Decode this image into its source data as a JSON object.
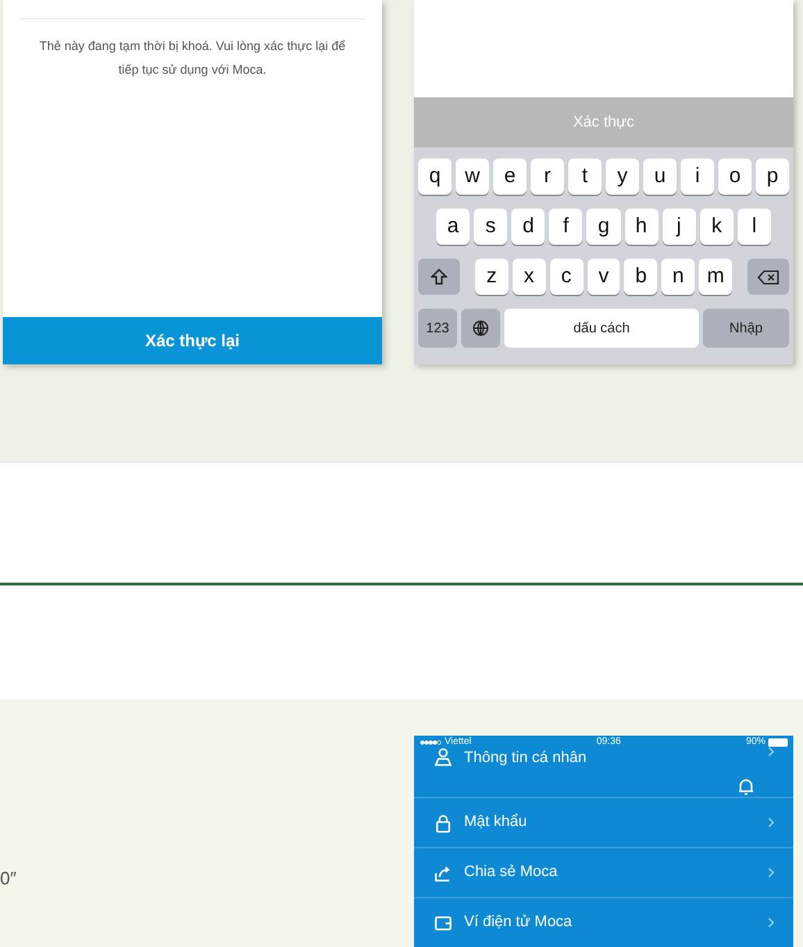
{
  "lock_screen": {
    "message": "Thẻ này đang tạm thời bị khoá. Vui lòng xác thực lại để tiếp tục sử dụng với Moca.",
    "button": "Xác thực lại"
  },
  "verify_screen": {
    "bar": "Xác thực",
    "keyboard": {
      "rows": [
        [
          "q",
          "w",
          "e",
          "r",
          "t",
          "y",
          "u",
          "i",
          "o",
          "p"
        ],
        [
          "a",
          "s",
          "d",
          "f",
          "g",
          "h",
          "j",
          "k",
          "l"
        ],
        [
          "z",
          "x",
          "c",
          "v",
          "b",
          "n",
          "m"
        ]
      ],
      "numbers_key": "123",
      "space_key": "dấu cách",
      "return_key": "Nhập"
    }
  },
  "text_fragment": "0″",
  "menu_screen": {
    "status_bar": {
      "carrier": "Viettel",
      "time": "09:36",
      "battery": "90%"
    },
    "items": [
      {
        "kind": "person",
        "label": "Thông tin cá nhân"
      },
      {
        "kind": "lock",
        "label": "Mật khẩu"
      },
      {
        "kind": "share",
        "label": "Chia sẻ Moca"
      },
      {
        "kind": "wallet",
        "label": "Ví điện tử Moca"
      }
    ]
  }
}
